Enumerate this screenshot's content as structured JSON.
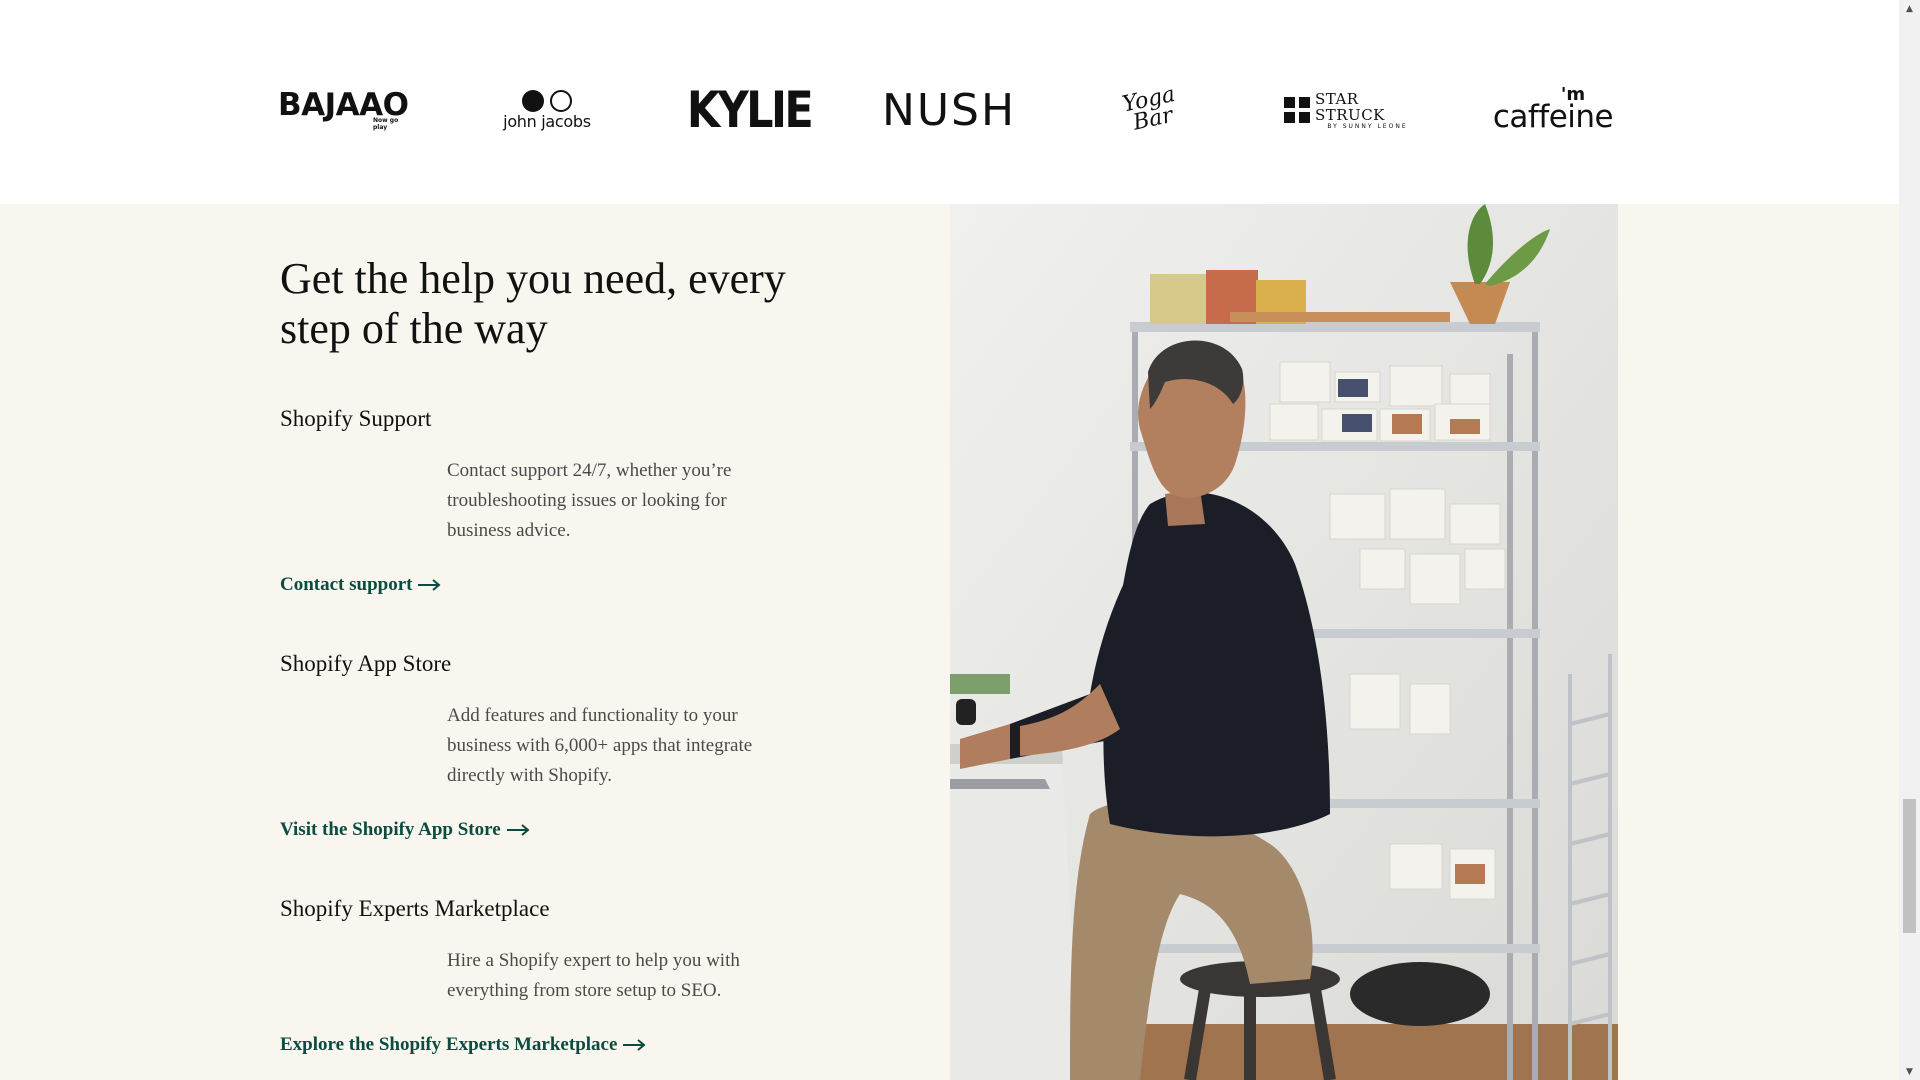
{
  "logos": [
    {
      "name": "BAJAAO",
      "tagline": "Now go play"
    },
    {
      "name": "john jacobs"
    },
    {
      "name": "KYLIE"
    },
    {
      "name": "NUSH"
    },
    {
      "name": "Yoga Bar",
      "line1": "Yoga",
      "line2": "Bar"
    },
    {
      "name": "STAR STRUCK",
      "subline": "BY SUNNY LEONE"
    },
    {
      "name": "i'm caffeine",
      "prefix": "'m",
      "word": "caffeine"
    }
  ],
  "help": {
    "heading": "Get the help you need, every step of the way",
    "sections": [
      {
        "title": "Shopify Support",
        "description": "Contact support 24/7, whether you’re troubleshooting issues or looking for business advice.",
        "link": "Contact support"
      },
      {
        "title": "Shopify App Store",
        "description": "Add features and functionality to your business with 6,000+ apps that integrate directly with Shopify.",
        "link": "Visit the Shopify App Store"
      },
      {
        "title": "Shopify Experts Marketplace",
        "description": "Hire a Shopify expert to help you with everything from store setup to SEO.",
        "link": "Explore the Shopify Experts Marketplace"
      }
    ],
    "link_icon": "arrow-right-icon",
    "link_color": "#0b4b40",
    "background_color": "#f9f6ef"
  },
  "scroll": {
    "position_fraction": 0.88
  }
}
